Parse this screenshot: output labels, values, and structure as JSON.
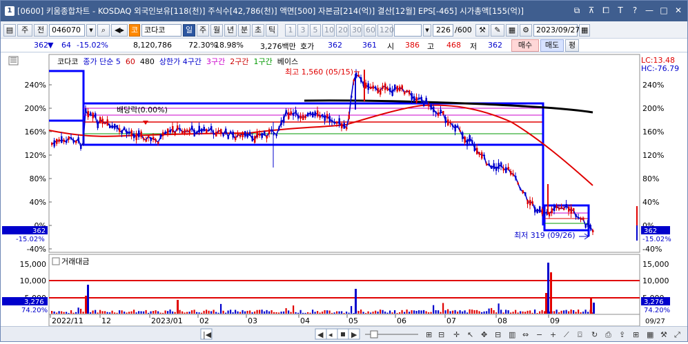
{
  "title": {
    "num": "1",
    "text": "[0600] 키움종합차트 - KOSDAQ 외국인보유[118(천)] 주식수[42,786(천)] 액면[500] 자본금[214(억)] 결산[12월] EPS[-465] 시가총액[155(억)]"
  },
  "toolbar": {
    "mode": "주",
    "mode2": "전",
    "code": "046070",
    "market_tag": "코",
    "name": "코다코",
    "periods": [
      "일",
      "주",
      "월",
      "년",
      "분",
      "초",
      "틱"
    ],
    "steps": [
      "1",
      "3",
      "5",
      "10",
      "20",
      "30",
      "60",
      "120"
    ],
    "count": "226",
    "total": "/600",
    "date": "2023/09/27"
  },
  "quote": {
    "price": "362",
    "change": "64",
    "rate": "-15.02%",
    "volume": "8,120,786",
    "vol_ratio": "72.30%",
    "turnover": "18.98%",
    "amount": "3,276백만",
    "hoga_label": "호가",
    "hoga": "362",
    "hoga2": "361",
    "open_label": "시",
    "open": "386",
    "high_label": "고",
    "high": "468",
    "low_label": "저",
    "low": "362",
    "buy": "매수",
    "sell": "매도",
    "flat": "평"
  },
  "chart": {
    "legend": [
      {
        "text": "코다코",
        "color": "#000000"
      },
      {
        "text": "종가 단순 5",
        "color": "#0000cc"
      },
      {
        "text": "60",
        "color": "#cc0000"
      },
      {
        "text": "480",
        "color": "#000000"
      },
      {
        "text": "상한가 4구간",
        "color": "#0000cc"
      },
      {
        "text": "3구간",
        "color": "#cc00cc"
      },
      {
        "text": "2구간",
        "color": "#cc0000"
      },
      {
        "text": "1구간",
        "color": "#009900"
      },
      {
        "text": "베이스",
        "color": "#000000"
      }
    ],
    "lc": "LC:13.48",
    "hc": "HC:-76.79",
    "y_labels": [
      "240%",
      "200%",
      "160%",
      "120%",
      "80%",
      "40%",
      "0%",
      "-40%"
    ],
    "price_tag": "362",
    "pct_tag": "-15.02%",
    "high_note": "최고 1,560 (05/15)",
    "low_note": "최저 319 (09/26)",
    "div_note": "배당락(0.00%)",
    "vol_title": "거래대금",
    "vol_labels": [
      "15,000",
      "10,000",
      "5,000"
    ],
    "vol_tag": "3,276",
    "vol_pct": "74.20%",
    "x_labels": [
      "2022/11",
      "12",
      "2023/01",
      "02",
      "03",
      "04",
      "05",
      "06",
      "07",
      "08",
      "09"
    ],
    "x_right": "09/27"
  },
  "colors": {
    "up": "#e00000",
    "down": "#0000cc",
    "accent": "#2c56a0"
  }
}
